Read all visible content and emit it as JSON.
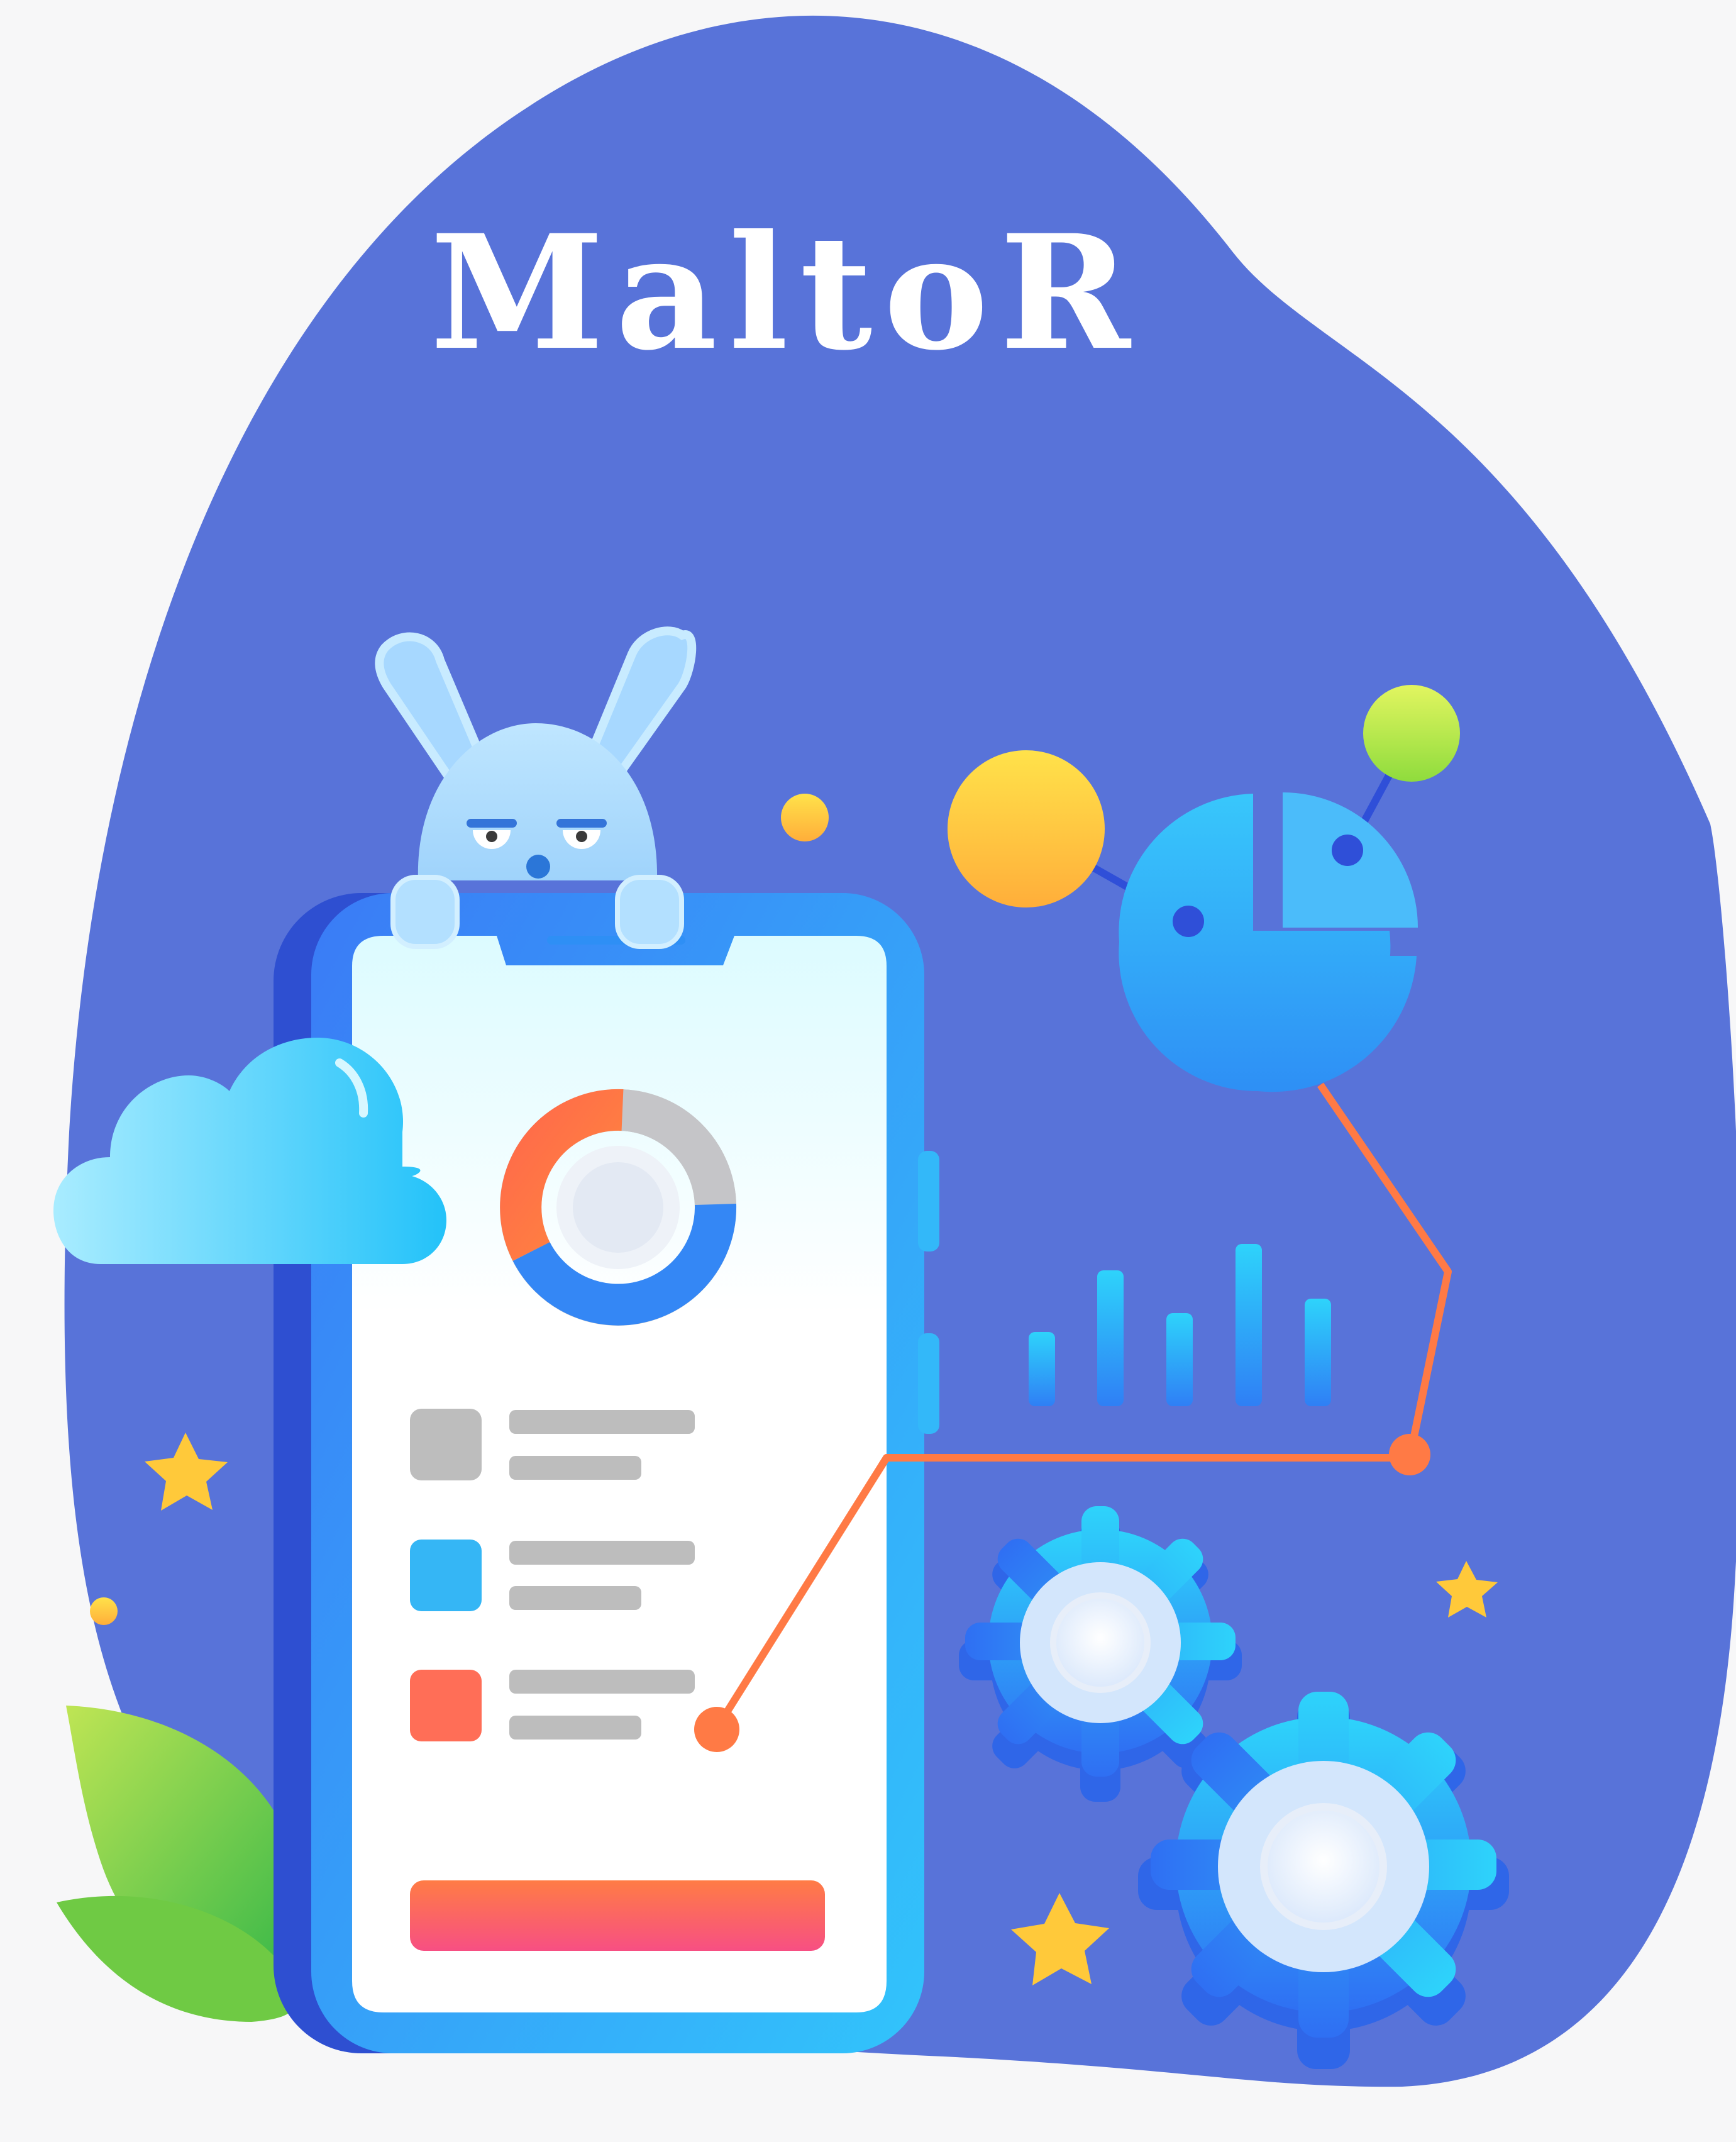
{
  "app": {
    "title": "MaltoR"
  },
  "colors": {
    "page_background": "#f7f7f8",
    "blob": "#5873d9",
    "phone_frame": "#3a8bf5",
    "screen": "#ffffff",
    "accent_orange": "#ff7a45",
    "accent_pink": "#f7507f",
    "accent_yellow": "#ffc93a",
    "accent_green": "#b9e845",
    "cyan": "#35c6f7"
  },
  "icons": [
    "rabbit-mascot-icon",
    "cloud-icon",
    "donut-chart-icon",
    "pie-chart-icon",
    "bar-chart-icon",
    "gear-icon",
    "star-icon",
    "leaf-icon"
  ],
  "phone": {
    "donut_progress": 0.7,
    "list_item_colors": [
      "#bdbdbd",
      "#35b6f5",
      "#ff6e57"
    ]
  }
}
